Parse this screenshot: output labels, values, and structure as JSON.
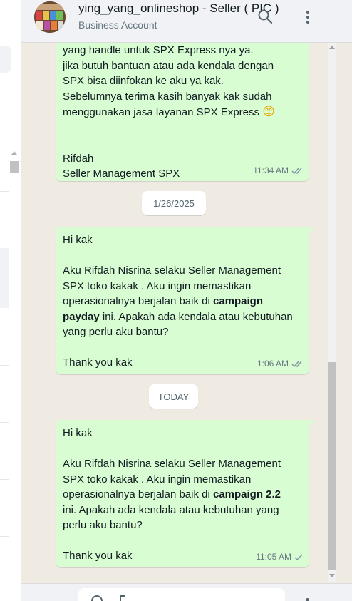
{
  "contact": {
    "name": "ying_yang_onlineshop - Seller ( PIC )",
    "subtitle": "Business Account"
  },
  "messages": [
    {
      "lines": [
        [
          "yang handle untuk SPX Express nya ya."
        ],
        [
          "jika butuh bantuan atau ada kendala dengan"
        ],
        [
          "SPX bisa diinfokan ke aku ya kak."
        ],
        [
          "Sebelumnya terima kasih banyak kak sudah"
        ],
        [
          "menggunakan jasa layanan SPX Express ",
          "😊"
        ],
        [
          ""
        ],
        [
          ""
        ],
        [
          "Rifdah"
        ],
        [
          "Seller Management SPX"
        ]
      ],
      "time": "11:34 AM",
      "status": "read"
    },
    {
      "lines": [
        [
          "Hi kak"
        ],
        [
          ""
        ],
        [
          "Aku Rifdah Nisrina selaku Seller Management"
        ],
        [
          "SPX toko kakak . Aku ingin memastikan"
        ],
        [
          "operasionalnya berjalan baik di ",
          "campaign"
        ],
        [
          "payday",
          " ini. Apakah ada kendala atau kebutuhan"
        ],
        [
          "yang perlu aku bantu?"
        ],
        [
          ""
        ],
        [
          "Thank you kak"
        ]
      ],
      "time": "1:06 AM",
      "status": "read"
    },
    {
      "lines": [
        [
          "Hi kak"
        ],
        [
          ""
        ],
        [
          "Aku Rifdah Nisrina selaku Seller Management"
        ],
        [
          "SPX toko kakak . Aku ingin memastikan"
        ],
        [
          "operasionalnya berjalan baik di ",
          "campaign 2.2"
        ],
        [
          "ini. Apakah ada kendala atau kebutuhan yang"
        ],
        [
          "perlu aku bantu?"
        ],
        [
          ""
        ],
        [
          "Thank you kak"
        ]
      ],
      "time": "11:05 AM",
      "status": "delivered"
    }
  ],
  "date_separators": [
    "1/26/2025",
    "TODAY"
  ],
  "colors": {
    "bubble_out": "#d9fdd3",
    "chat_bg": "#efeae2",
    "read_tick": "#8696a0",
    "header_bg": "#f0f2f5"
  },
  "icons": [
    "search-icon",
    "menu-icon",
    "double-check-icon",
    "check-icon",
    "smiling-face-emoji"
  ]
}
